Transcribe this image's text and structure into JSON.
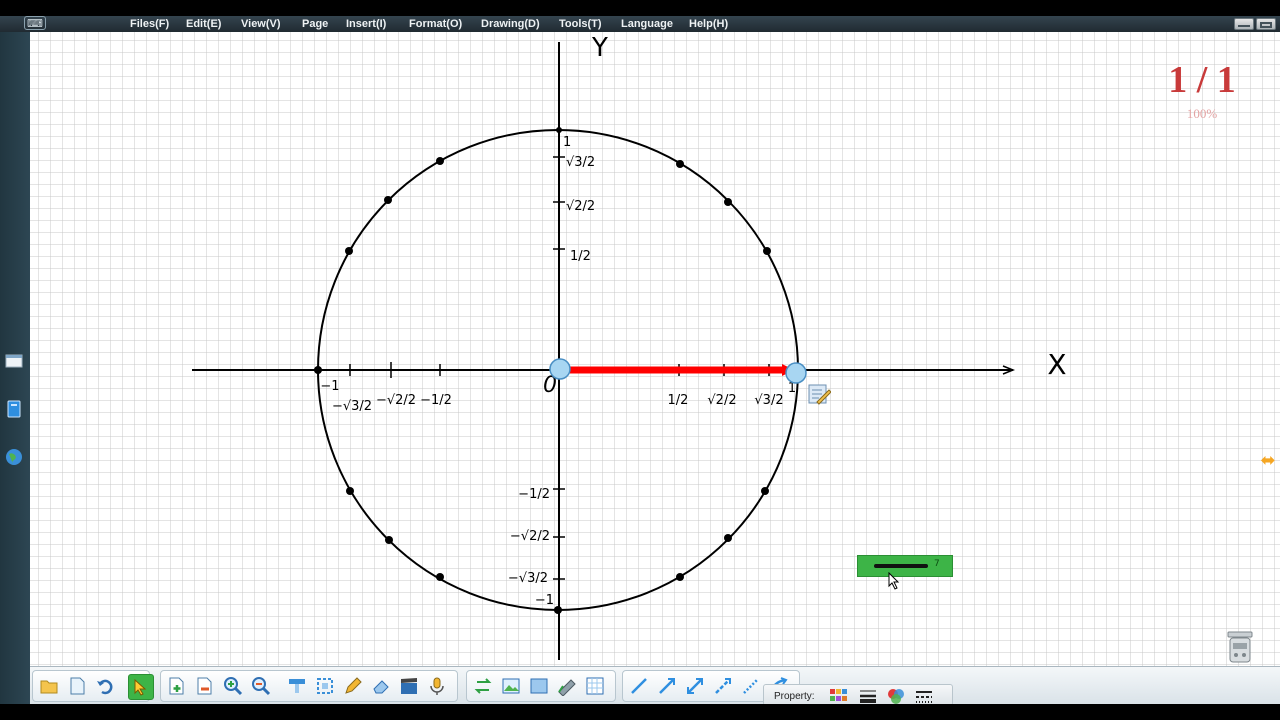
{
  "menu": {
    "items": [
      {
        "label": "Files(F)"
      },
      {
        "label": "Edit(E)"
      },
      {
        "label": "View(V)"
      },
      {
        "label": "Page"
      },
      {
        "label": "Insert(I)"
      },
      {
        "label": "Format(O)"
      },
      {
        "label": "Drawing(D)"
      },
      {
        "label": "Tools(T)"
      },
      {
        "label": "Language"
      },
      {
        "label": "Help(H)"
      }
    ]
  },
  "board": {
    "page_counter": "1 / 1",
    "zoom": "100%",
    "axis_x_label": "X",
    "axis_y_label": "Y",
    "origin_label": "0",
    "line_width_value": "7",
    "unit_circle": {
      "x_ticks_positive": [
        "1/2",
        "√2/2",
        "√3/2",
        "1"
      ],
      "x_ticks_negative": [
        "−1/2",
        "−√2/2",
        "−√3/2",
        "−1"
      ],
      "y_ticks_positive": [
        "1/2",
        "√2/2",
        "√3/2",
        "1"
      ],
      "y_ticks_negative": [
        "−1/2",
        "−√2/2",
        "−√3/2",
        "−1"
      ],
      "red_vector": "from origin (0,0) to (1,0)",
      "marked_points_deg": [
        0,
        30,
        45,
        60,
        90,
        120,
        135,
        150,
        180,
        210,
        225,
        240,
        270,
        300,
        315,
        330
      ]
    }
  },
  "toolbar": {
    "property_label": "Property:",
    "tools": [
      "open-file",
      "new-page",
      "undo",
      "select",
      "add-page",
      "delete-page",
      "zoom-in",
      "zoom-out",
      "screen-shade",
      "spotlight",
      "pen",
      "eraser",
      "record",
      "microphone",
      "switch",
      "image",
      "background",
      "ruler",
      "grid",
      "line",
      "arrow",
      "double-arrow",
      "dashed-line",
      "dotted-line",
      "curve-arrow"
    ]
  },
  "colors": {
    "menu_bg": "#26333b",
    "grid_line": "#c9c9c9",
    "accent_green": "#3db447",
    "vector_red": "#ff0000",
    "page_counter": "#c83a3a"
  }
}
